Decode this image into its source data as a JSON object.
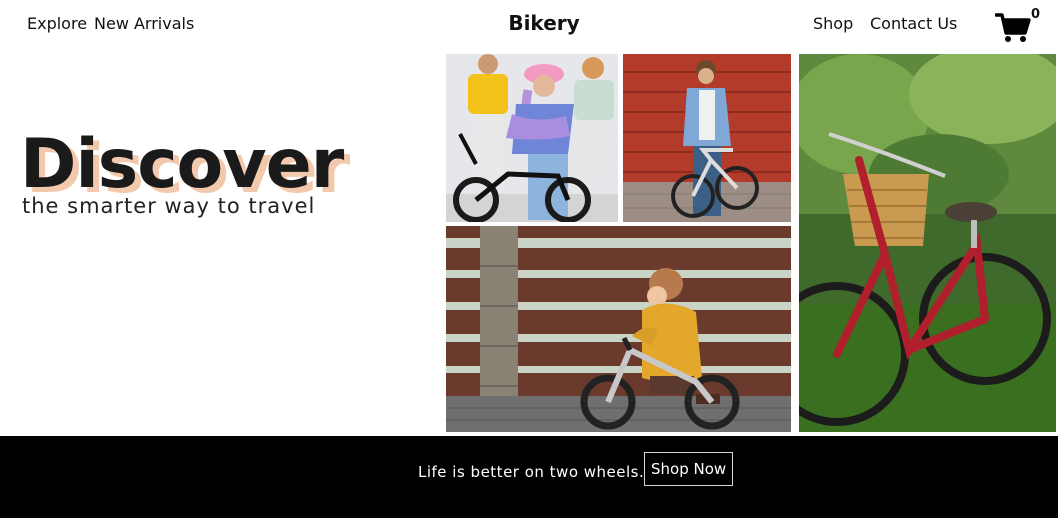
{
  "nav": {
    "left_links": [
      "Explore",
      "New Arrivals"
    ],
    "brand": "Bikery",
    "right_links": [
      "Shop",
      "Contact Us"
    ],
    "cart_count": "0",
    "cart_icon": "shopping-cart-icon"
  },
  "hero": {
    "title": "Discover",
    "subtitle": "the smarter way to travel",
    "title_shadow_color": "#f2c9ad"
  },
  "gallery": [
    {
      "scene": "teens-with-bmx-bike"
    },
    {
      "scene": "young-man-with-bike-at-red-wall"
    },
    {
      "scene": "toddler-on-balance-bike"
    },
    {
      "scene": "red-bicycle-with-basket-on-grass"
    }
  ],
  "footer": {
    "tagline": "Life is better on two wheels.",
    "cta_label": "Shop Now",
    "background": "#000000"
  }
}
